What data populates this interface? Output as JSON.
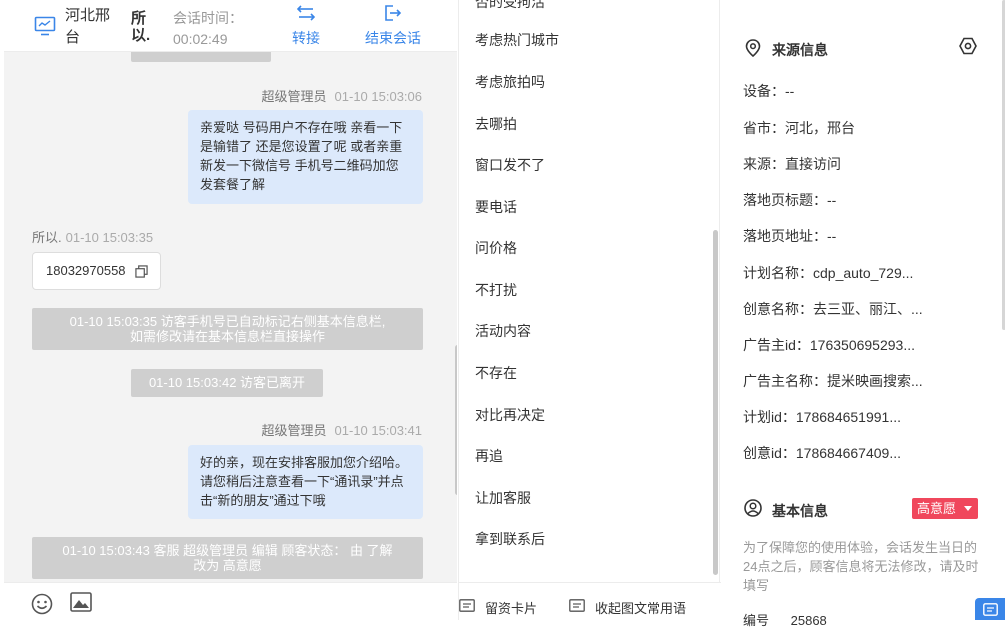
{
  "header": {
    "location": "河北邢台",
    "visitor": "所以.",
    "time_label": "会话时间：",
    "time_value": "00:02:49",
    "transfer_label": "转接",
    "end_label": "结束会话"
  },
  "chat": {
    "msg1": {
      "sender": "超级管理员",
      "time": "01-10 15:03:06",
      "text": "亲爱哒 号码用户不存在哦 亲看一下是输错了 还是您设置了呢 或者亲重新发一下微信号 手机号二维码加您发套餐了解"
    },
    "msg2": {
      "sender": "所以.",
      "time": "01-10 15:03:35",
      "phone": "18032970558"
    },
    "sys1": {
      "line1": "01-10 15:03:35 访客手机号已自动标记右侧基本信息栏,",
      "line2": "如需修改请在基本信息栏直接操作"
    },
    "sys2": "01-10 15:03:42 访客已离开",
    "msg3": {
      "sender": "超级管理员",
      "time": "01-10 15:03:41",
      "text": "好的亲，现在安排客服加您介绍哈。请您稍后注意查看一下“通讯录”并点击“新的朋友”通过下哦"
    },
    "sys3": {
      "line1": "01-10 15:03:43 客服 超级管理员 编辑 顾客状态： 由 了解",
      "line2": "改为 高意愿"
    }
  },
  "phrases": [
    "考虑热门城市",
    "考虑旅拍吗",
    "去哪拍",
    "窗口发不了",
    "要电话",
    "问价格",
    "不打扰",
    "活动内容",
    "不存在",
    "对比再决定",
    "再追",
    "让加客服",
    "拿到联系后"
  ],
  "phrases_footer": {
    "card": "留资卡片",
    "collect": "收起图文常用语"
  },
  "source_info": {
    "title": "来源信息",
    "rows": [
      "设备：--",
      "省市：河北，邢台",
      "来源：直接访问",
      "落地页标题：--",
      "落地页地址：--",
      "计划名称：cdp_auto_729...",
      "创意名称：去三亚、丽江、...",
      "广告主id：176350695293...",
      "广告主名称：提米映画搜索...",
      "计划id：178684651991...",
      "创意id：178684667409..."
    ]
  },
  "basic_info": {
    "title": "基本信息",
    "intent": "高意愿",
    "notice": "为了保障您的使用体验，会话发生当日的24点之后，顾客信息将无法修改，请及时填写",
    "serial_label": "编号",
    "serial_value": "25868"
  },
  "colors": {
    "accent": "#3a86e8",
    "bubble": "#dce9fb",
    "badge": "#f0475c",
    "system_pill": "#cfcfcf"
  }
}
